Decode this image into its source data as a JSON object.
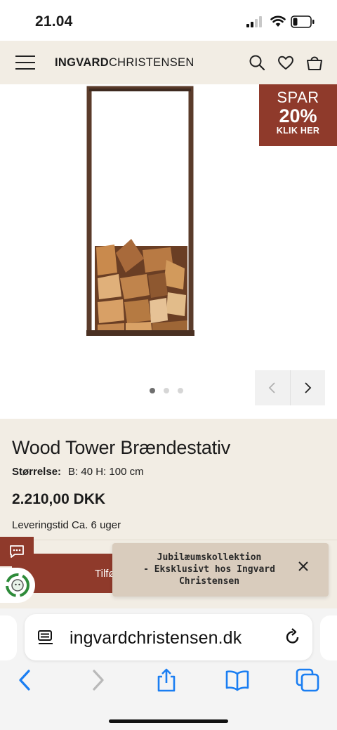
{
  "status_bar": {
    "time": "21.04"
  },
  "header": {
    "logo_bold": "INGVARD",
    "logo_light": "CHRISTENSEN",
    "icons": [
      "menu-icon",
      "search-icon",
      "heart-icon",
      "bag-icon"
    ]
  },
  "promo": {
    "line1": "SPAR",
    "line2": "20%",
    "line3": "KLIK HER"
  },
  "gallery": {
    "slide_count": 3,
    "active_slide": 1
  },
  "product": {
    "title": "Wood Tower Brændestativ",
    "size_label": "Størrelse:",
    "size_value": "B: 40 H: 100 cm",
    "price": "2.210,00 DKK",
    "delivery": "Leveringstid Ca. 6 uger",
    "add_to_cart_visible": "Tilfø"
  },
  "toast": {
    "line1": "Jubilæumskollektion",
    "line2": "- Eksklusivt hos Ingvard",
    "line3": "Christensen"
  },
  "browser": {
    "url": "ingvardchristensen.dk",
    "icons": [
      "reader-icon",
      "reload-icon",
      "back-icon",
      "forward-icon",
      "share-icon",
      "bookmarks-icon",
      "tabs-icon"
    ]
  },
  "colors": {
    "accent": "#8f3a2b",
    "header_bg": "#f2ede4",
    "toast_bg": "#d9ccbd"
  }
}
